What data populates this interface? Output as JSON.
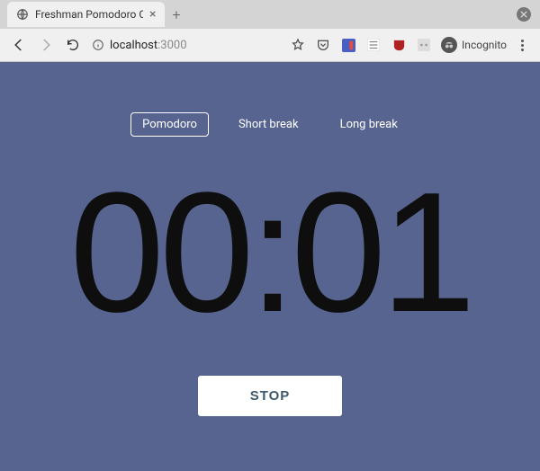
{
  "browser": {
    "tab_title": "Freshman Pomodoro Cloc",
    "address_host": "localhost",
    "address_port": ":3000",
    "incognito_label": "Incognito"
  },
  "app": {
    "modes": {
      "pomodoro": "Pomodoro",
      "short_break": "Short break",
      "long_break": "Long break"
    },
    "timer_display": "00:01",
    "action_label": "STOP"
  }
}
